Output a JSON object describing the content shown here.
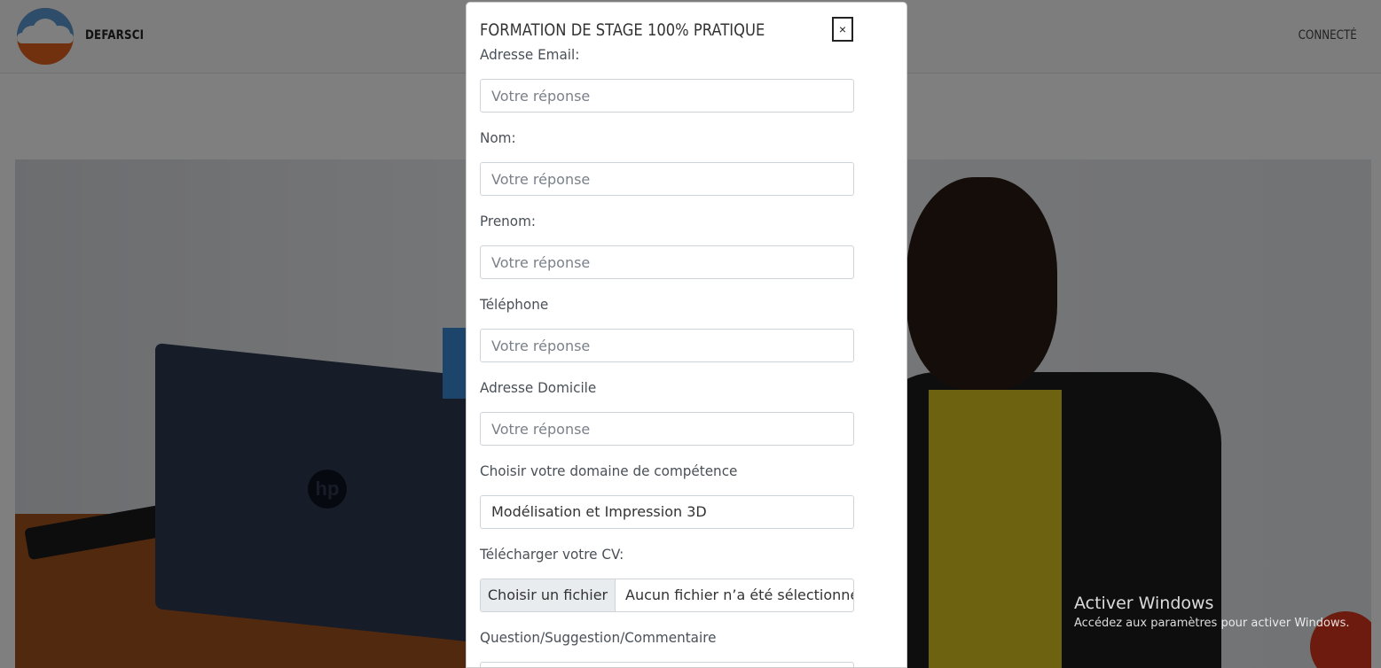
{
  "navbar": {
    "brand": "DEFARSCI",
    "connect_link": "CONNECTÉ"
  },
  "modal": {
    "title": "FORMATION DE STAGE 100% PRATIQUE",
    "close_label": "×",
    "fields": [
      {
        "label": "Adresse Email:",
        "placeholder": "Votre réponse"
      },
      {
        "label": "Nom:",
        "placeholder": "Votre réponse"
      },
      {
        "label": "Prenom:",
        "placeholder": "Votre réponse"
      },
      {
        "label": "Téléphone",
        "placeholder": "Votre réponse"
      },
      {
        "label": "Adresse Domicile",
        "placeholder": "Votre réponse"
      }
    ],
    "domain": {
      "label": "Choisir votre domaine de compétence",
      "selected": "Modélisation et Impression 3D"
    },
    "cv": {
      "label": "Télécharger votre CV:",
      "button": "Choisir un fichier",
      "status": "Aucun fichier n’a été sélectionné"
    },
    "comment": {
      "label": "Question/Suggestion/Commentaire"
    }
  },
  "hero": {
    "logo_text": "hp"
  },
  "windows_watermark": {
    "line1": "Activer Windows",
    "line2": "Accédez aux paramètres pour activer Windows."
  }
}
